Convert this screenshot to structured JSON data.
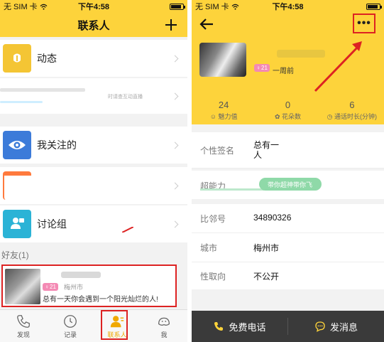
{
  "left": {
    "status": {
      "carrier": "无 SIM 卡",
      "time": "下午4:58"
    },
    "title": "联系人",
    "rows": [
      {
        "label": "动态"
      },
      {
        "sub": "时请查互动直播"
      },
      {
        "label": "我关注的"
      },
      {
        "label": ""
      },
      {
        "label": "讨论组"
      }
    ],
    "friends_header": "好友(1)",
    "friend": {
      "age": "21",
      "city": "梅州市",
      "signature": "总有一天你会遇到一个阳光灿烂的人!"
    },
    "tabs": [
      {
        "label": "发现"
      },
      {
        "label": "记录"
      },
      {
        "label": "联系人"
      },
      {
        "label": "我"
      }
    ]
  },
  "right": {
    "status": {
      "carrier": "无 SIM 卡",
      "time": "下午4:58"
    },
    "more": "•••",
    "age": "21",
    "last_seen": "一周前",
    "stats": [
      {
        "num": "24",
        "label": "魅力值"
      },
      {
        "num": "0",
        "label": "花朵数"
      },
      {
        "num": "6",
        "label": "通话时长(分钟)"
      }
    ],
    "info": {
      "signature_key": "个性签名",
      "signature_val": "总有一\n人",
      "super_key": "超能力",
      "super_pill": "带你超神带你飞",
      "id_key": "比邻号",
      "id_val": "34890326",
      "city_key": "城市",
      "city_val": "梅州市",
      "orientation_key": "性取向",
      "orientation_val": "不公开"
    },
    "buttons": {
      "call": "免费电话",
      "message": "发消息"
    }
  },
  "colors": {
    "brand": "#fdd33b",
    "annotation": "#dd2222",
    "dark_bar": "#3a3a3a"
  }
}
